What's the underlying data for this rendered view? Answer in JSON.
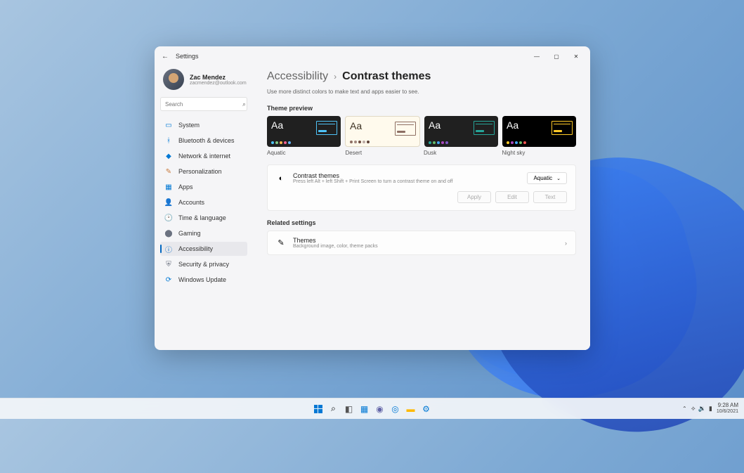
{
  "window": {
    "title": "Settings",
    "profile_name": "Zac Mendez",
    "profile_email": "zacmendez@outlook.com",
    "search_placeholder": "Search"
  },
  "sidebar": {
    "items": [
      {
        "label": "System",
        "icon_color": "#0078d4"
      },
      {
        "label": "Bluetooth & devices",
        "icon_color": "#0078d4"
      },
      {
        "label": "Network & internet",
        "icon_color": "#0078d4"
      },
      {
        "label": "Personalization",
        "icon_color": "#c97b3f"
      },
      {
        "label": "Apps",
        "icon_color": "#0078d4"
      },
      {
        "label": "Accounts",
        "icon_color": "#e28f5b"
      },
      {
        "label": "Time & language",
        "icon_color": "#5b8fc9"
      },
      {
        "label": "Gaming",
        "icon_color": "#6b7280"
      },
      {
        "label": "Accessibility",
        "icon_color": "#0067c0"
      },
      {
        "label": "Security & privacy",
        "icon_color": "#6b7280"
      },
      {
        "label": "Windows Update",
        "icon_color": "#0078d4"
      }
    ]
  },
  "content": {
    "breadcrumb_parent": "Accessibility",
    "breadcrumb_current": "Contrast themes",
    "description": "Use more distinct colors to make text and apps easier to see.",
    "preview_label": "Theme preview",
    "themes": [
      {
        "name": "Aquatic",
        "bg": "#202020",
        "fg": "#ffffff",
        "accent": "#4fc3f7",
        "dots": [
          "#4fc3f7",
          "#81c784",
          "#ffb74d",
          "#f06292",
          "#64b5f6"
        ]
      },
      {
        "name": "Desert",
        "bg": "#fffaed",
        "fg": "#3d3223",
        "accent": "#8d6e63",
        "dots": [
          "#8d6e63",
          "#a1887f",
          "#6d4c41",
          "#bcaaa4",
          "#5d4037"
        ]
      },
      {
        "name": "Dusk",
        "bg": "#202020",
        "fg": "#ffffff",
        "accent": "#26a69a",
        "dots": [
          "#26a69a",
          "#66bb6a",
          "#42a5f5",
          "#ab47bc",
          "#7e57c2"
        ]
      },
      {
        "name": "Night sky",
        "bg": "#000000",
        "fg": "#ffffff",
        "accent": "#ffca28",
        "dots": [
          "#ffca28",
          "#ab47bc",
          "#42a5f5",
          "#66bb6a",
          "#ef5350"
        ]
      }
    ],
    "contrast_card": {
      "title": "Contrast themes",
      "subtitle": "Press left Alt + left Shift + Print Screen to turn a contrast theme on and off",
      "dropdown_value": "Aquatic",
      "btn_apply": "Apply",
      "btn_edit": "Edit",
      "btn_text": "Text"
    },
    "related_label": "Related settings",
    "themes_link": {
      "title": "Themes",
      "subtitle": "Background image, color, theme packs"
    }
  },
  "taskbar": {
    "time": "9:28 AM",
    "date": "10/6/2021"
  }
}
